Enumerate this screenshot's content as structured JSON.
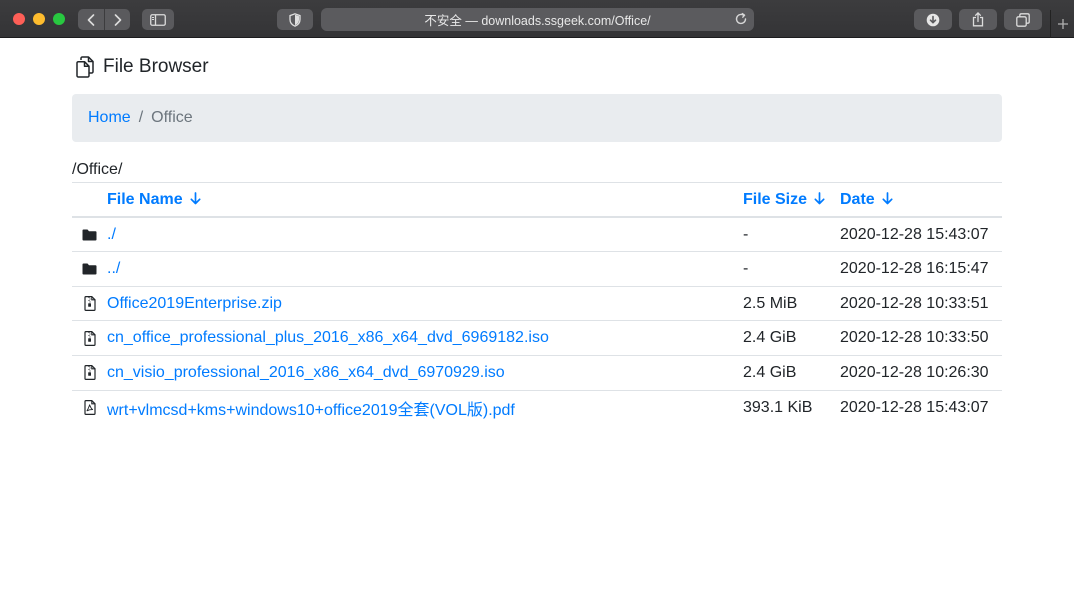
{
  "browser": {
    "url_text": "不安全 — downloads.ssgeek.com/Office/"
  },
  "header": {
    "title": "File Browser"
  },
  "breadcrumb": {
    "home": "Home",
    "separator": "/",
    "current": "Office"
  },
  "path": "/Office/",
  "table": {
    "columns": {
      "name": "File Name",
      "size": "File Size",
      "date": "Date"
    },
    "rows": [
      {
        "icon": "folder-icon",
        "name": "./",
        "size": "-",
        "date": "2020-12-28 15:43:07"
      },
      {
        "icon": "folder-icon",
        "name": "../",
        "size": "-",
        "date": "2020-12-28 16:15:47"
      },
      {
        "icon": "archive-file-icon",
        "name": "Office2019Enterprise.zip",
        "size": "2.5 MiB",
        "date": "2020-12-28 10:33:51"
      },
      {
        "icon": "archive-file-icon",
        "name": "cn_office_professional_plus_2016_x86_x64_dvd_6969182.iso",
        "size": "2.4 GiB",
        "date": "2020-12-28 10:33:50"
      },
      {
        "icon": "archive-file-icon",
        "name": "cn_visio_professional_2016_x86_x64_dvd_6970929.iso",
        "size": "2.4 GiB",
        "date": "2020-12-28 10:26:30"
      },
      {
        "icon": "pdf-file-icon",
        "name": "wrt+vlmcsd+kms+windows10+office2019全套(VOL版).pdf",
        "size": "393.1 KiB",
        "date": "2020-12-28 15:43:07"
      }
    ]
  },
  "colors": {
    "link": "#007bff",
    "breadcrumb_bg": "#e9ecef",
    "muted": "#6c757d",
    "text": "#212529"
  }
}
